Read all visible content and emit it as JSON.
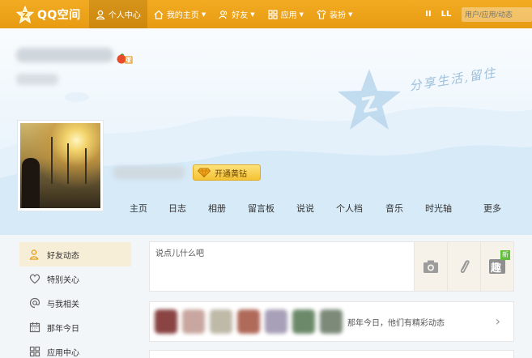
{
  "topbar": {
    "logo_text": "QQ空间",
    "nav": [
      {
        "label": "个人中心",
        "icon": "person-icon",
        "active": true,
        "caret": ""
      },
      {
        "label": "我的主页",
        "icon": "home-icon",
        "active": false,
        "caret": "▼"
      },
      {
        "label": "好友",
        "icon": "friends-icon",
        "active": false,
        "caret": "▼"
      },
      {
        "label": "应用",
        "icon": "apps-grid-icon",
        "active": false,
        "caret": "▼"
      },
      {
        "label": "装扮",
        "icon": "shirt-icon",
        "active": false,
        "caret": "▼"
      }
    ],
    "right_buttons": [
      "II",
      "LL"
    ],
    "search_placeholder": "用户/应用/动态"
  },
  "header": {
    "slogan": "分享生活,留住",
    "vip_button": "开通黄钻"
  },
  "tabs": [
    "主页",
    "日志",
    "相册",
    "留言板",
    "说说",
    "个人档",
    "音乐",
    "时光轴",
    "更多"
  ],
  "sidebar": {
    "items": [
      {
        "label": "好友动态",
        "icon": "friends-feed-icon",
        "active": true
      },
      {
        "label": "特别关心",
        "icon": "heart-icon",
        "active": false
      },
      {
        "label": "与我相关",
        "icon": "at-icon",
        "active": false
      },
      {
        "label": "那年今日",
        "icon": "calendar-icon",
        "active": false
      },
      {
        "label": "应用中心",
        "icon": "apps-icon",
        "active": false
      }
    ]
  },
  "postbox": {
    "placeholder": "说点儿什么吧",
    "tools": [
      "camera-icon",
      "link-icon",
      "qu-icon"
    ],
    "new_badge": "新",
    "qu_label": "趣"
  },
  "memory": {
    "text": "那年今日，他们有精彩动态",
    "arrow": "›"
  },
  "colors": {
    "topbar": "#e79b12",
    "accent": "#f5c133",
    "sky": "#dbeefa"
  }
}
